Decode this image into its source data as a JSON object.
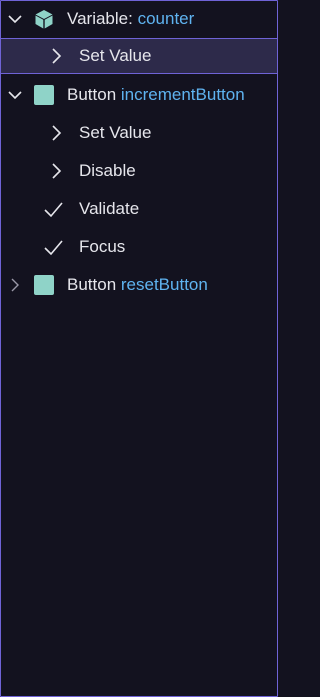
{
  "tree": {
    "variable": {
      "kind": "Variable:",
      "name": "counter",
      "icon": "cube-icon",
      "expanded": true,
      "children": [
        {
          "label": "Set Value",
          "icon": "chevron-right-icon"
        }
      ]
    },
    "increment_button": {
      "kind": "Button",
      "name": "incrementButton",
      "icon": "square-icon",
      "expanded": true,
      "children": [
        {
          "label": "Set Value",
          "icon": "chevron-right-icon"
        },
        {
          "label": "Disable",
          "icon": "chevron-right-icon"
        },
        {
          "label": "Validate",
          "icon": "check-icon"
        },
        {
          "label": "Focus",
          "icon": "check-icon"
        }
      ]
    },
    "reset_button": {
      "kind": "Button",
      "name": "resetButton",
      "icon": "square-icon",
      "expanded": false
    }
  },
  "colors": {
    "background": "#13121f",
    "accent_border": "#6f63d6",
    "selection": "#2d2a4a",
    "identifier": "#5fb3f0",
    "node_icon": "#8fd3c8"
  }
}
